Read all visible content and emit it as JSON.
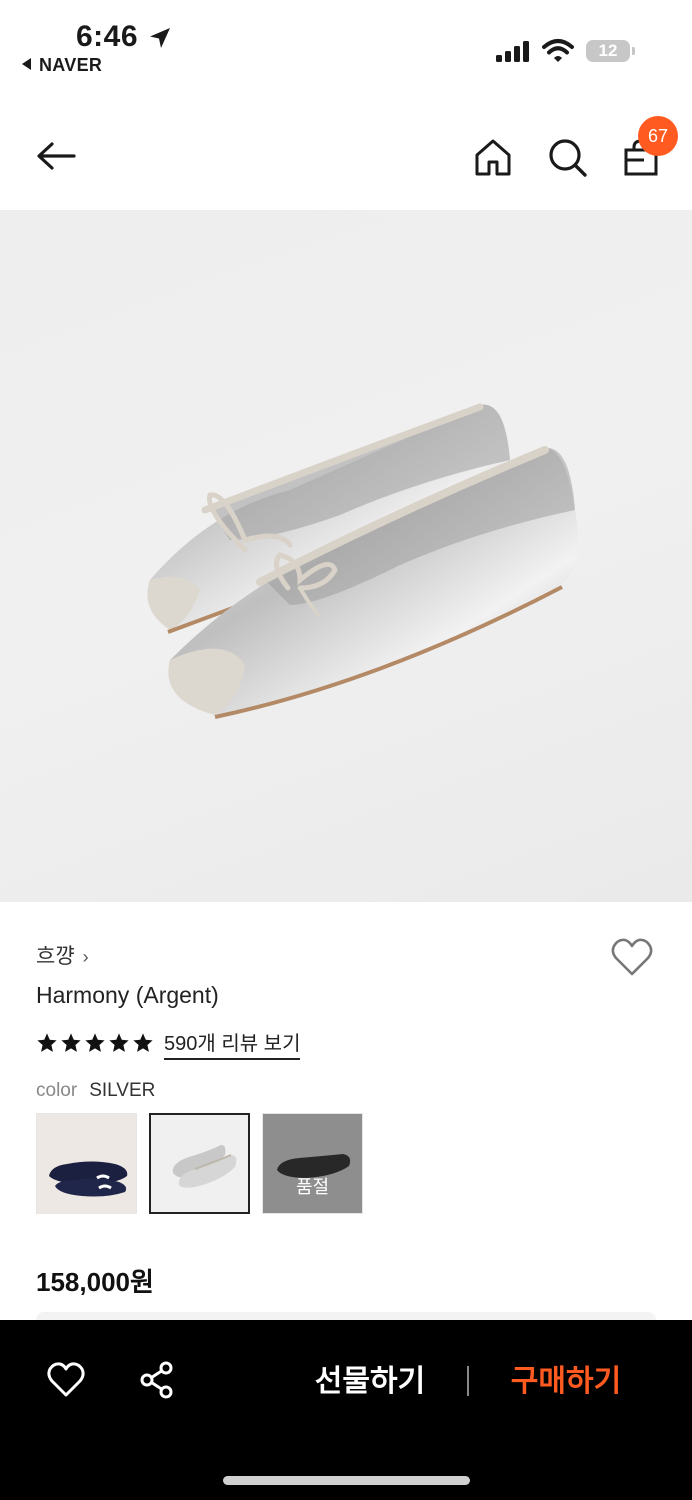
{
  "status_bar": {
    "time": "6:46",
    "back_app": "NAVER",
    "battery": "12"
  },
  "header": {
    "cart_count": "67",
    "icons": [
      "back-arrow-icon",
      "home-icon",
      "search-icon",
      "shopping-bag-icon"
    ]
  },
  "product": {
    "brand": "흐꺙",
    "brand_chevron": "›",
    "name": "Harmony (Argent)",
    "rating_stars": 5,
    "review_link": "590개 리뷰 보기",
    "color_label": "color",
    "color_value": "SILVER",
    "swatches": [
      {
        "name": "navy",
        "selected": false,
        "soldout": false
      },
      {
        "name": "silver",
        "selected": true,
        "soldout": false
      },
      {
        "name": "black",
        "selected": false,
        "soldout": true,
        "soldout_label": "품절"
      }
    ],
    "price": "158,000원"
  },
  "bottom_bar": {
    "gift_label": "선물하기",
    "buy_label": "구매하기",
    "icons": [
      "heart-icon",
      "share-icon"
    ]
  },
  "colors": {
    "accent": "#ff5a1f",
    "bottom_bar_bg": "#000000"
  }
}
